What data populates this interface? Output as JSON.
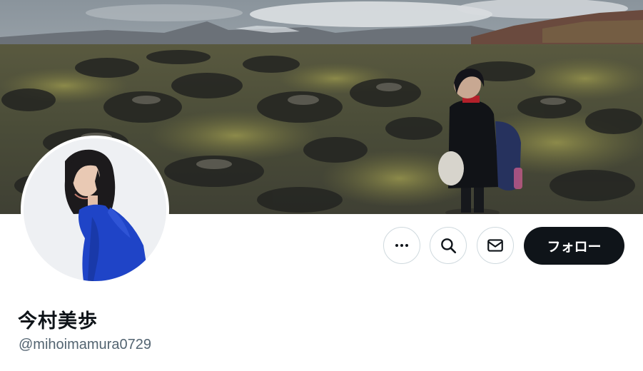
{
  "profile": {
    "display_name": "今村美歩",
    "handle": "@mihoimamura0729",
    "banner_image": "lava-field-landscape-photo",
    "avatar_image": "profile-photo"
  },
  "actions": {
    "more_icon": "more-horizontal-icon",
    "search_icon": "search-icon",
    "message_icon": "envelope-icon",
    "follow_label": "フォロー"
  },
  "colors": {
    "follow_button_bg": "#0f1419",
    "follow_button_text": "#ffffff",
    "name_text": "#0f1419",
    "handle_text": "#536471",
    "button_border": "#cfd9de"
  }
}
